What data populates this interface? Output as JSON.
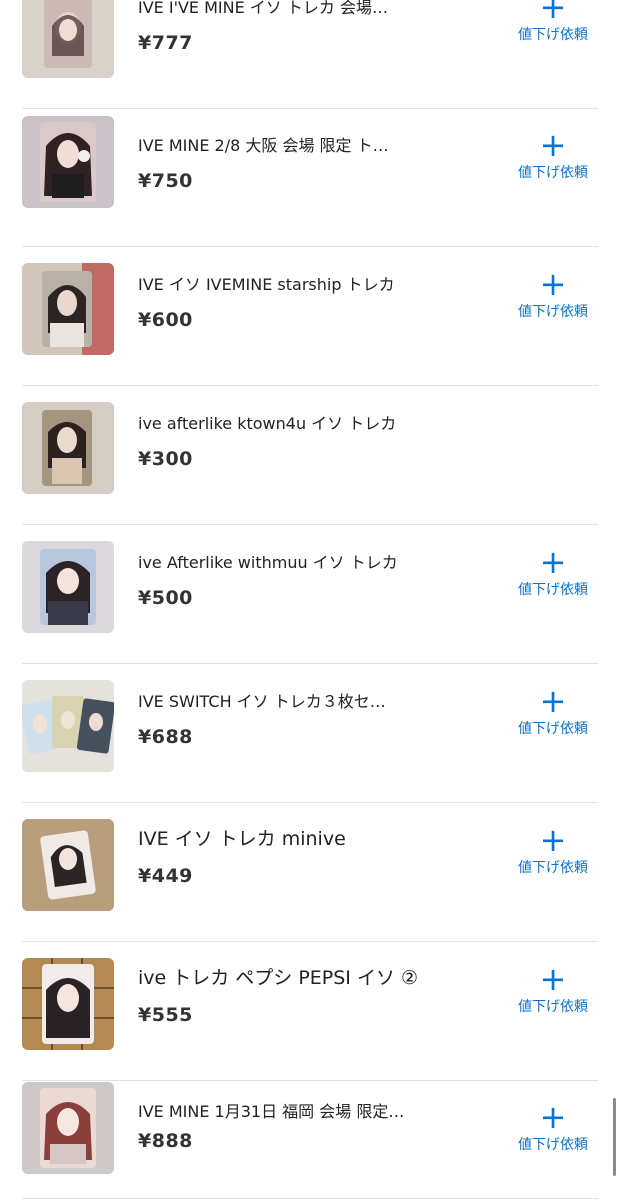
{
  "items": [
    {
      "title": "IVE I'VE MINE イソ トレカ 会場…",
      "price": "¥777",
      "action": "値下げ依頼",
      "plus": "+"
    },
    {
      "title": "IVE MINE 2/8 大阪 会場 限定 ト…",
      "price": "¥750",
      "action": "値下げ依頼",
      "plus": "+"
    },
    {
      "title": "IVE イソ IVEMINE starship トレカ",
      "price": "¥600",
      "action": "値下げ依頼",
      "plus": "+"
    },
    {
      "title": "ive afterlike ktown4u イソ トレカ",
      "price": "¥300"
    },
    {
      "title": "ive Afterlike withmuu イソ トレカ",
      "price": "¥500",
      "action": "値下げ依頼",
      "plus": "+"
    },
    {
      "title": "IVE SWITCH イソ トレカ３枚セ…",
      "price": "¥688",
      "action": "値下げ依頼",
      "plus": "+"
    },
    {
      "title": "IVE イソ トレカ minive",
      "price": "¥449",
      "action": "値下げ依頼",
      "plus": "+"
    },
    {
      "title": "ive トレカ ペプシ PEPSI イソ ②",
      "price": "¥555",
      "action": "値下げ依頼",
      "plus": "+"
    },
    {
      "title": "IVE MINE 1月31日 福岡 会場 限定…",
      "price": "¥888",
      "action": "値下げ依頼",
      "plus": "+"
    }
  ]
}
